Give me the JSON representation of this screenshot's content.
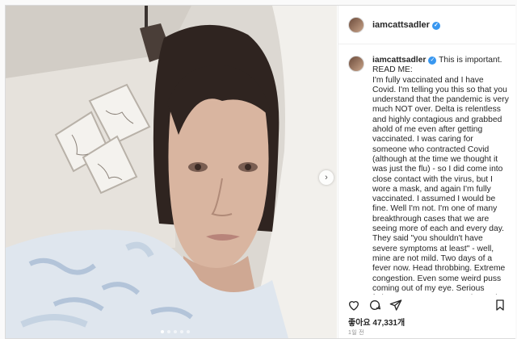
{
  "post": {
    "username": "iamcattsadler",
    "caption": "This is important.\nREAD ME:\nI'm fully vaccinated and I have Covid. I'm telling you this so that you understand that the pandemic is very much NOT over. Delta is relentless and highly contagious and grabbed ahold of me even after getting vaccinated. I was caring for someone who contracted Covid (although at the time we thought it was just the flu) - so I did come into close contact with the virus, but I wore a mask, and again I'm fully vaccinated. I assumed I would be fine. Well I'm not. I'm one of many breakthrough cases that we are seeing more of each and every day. They said \"you shouldn't have severe symptoms at least\" - well, mine are not mild. Two days of a fever now. Head throbbing. Extreme congestion. Even some weird puss coming out of my eye. Serious fatigue, no energy to even leave the",
    "likes_label": "좋아요 47,331개",
    "time": "1일 전",
    "carousel": {
      "count": 5,
      "active": 0
    }
  },
  "icons": {
    "verified": "verified-badge-icon",
    "like": "heart-icon",
    "comment": "comment-bubble-icon",
    "share": "paper-plane-icon",
    "save": "bookmark-icon",
    "next": "chevron-right-icon"
  }
}
